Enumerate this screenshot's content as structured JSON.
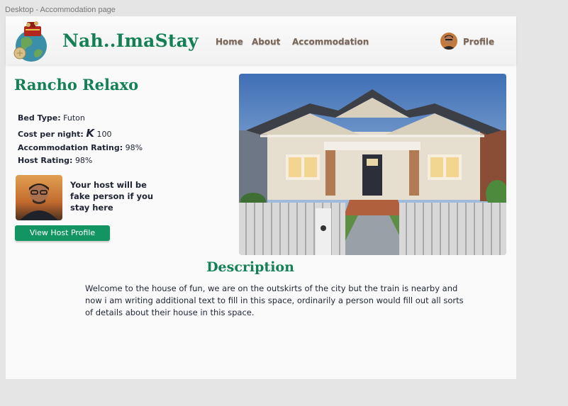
{
  "frame": {
    "label": "Desktop - Accommodation page"
  },
  "brand": {
    "name": "Nah..ImaStay",
    "logo_icon": "globe-luggage-logo-icon"
  },
  "nav": {
    "home": "Home",
    "about": "About",
    "accommodation": "Accommodation",
    "profile": "Profile"
  },
  "listing": {
    "title": "Rancho Relaxo",
    "bed_type_label": "Bed Type:",
    "bed_type_value": "Futon",
    "cost_label": "Cost per night:",
    "cost_currency_icon": "K",
    "cost_value": "100",
    "accommodation_rating_label": "Accommodation Rating:",
    "accommodation_rating_value": "98%",
    "host_rating_label": "Host Rating:",
    "host_rating_value": "98%"
  },
  "host": {
    "note": "Your host will be fake person if you stay here",
    "button_label": "View Host Profile"
  },
  "description": {
    "title": "Description",
    "text": "Welcome to the house of fun, we are on the outskirts of the city but the train is nearby and now i am writing additional text to fill in this space, ordinarily a person would fill out all sorts of details about their house in this space."
  },
  "colors": {
    "brand_green": "#138055",
    "button_green": "#139463",
    "nav_text": "#7a6557",
    "body_text": "#1e2433"
  }
}
